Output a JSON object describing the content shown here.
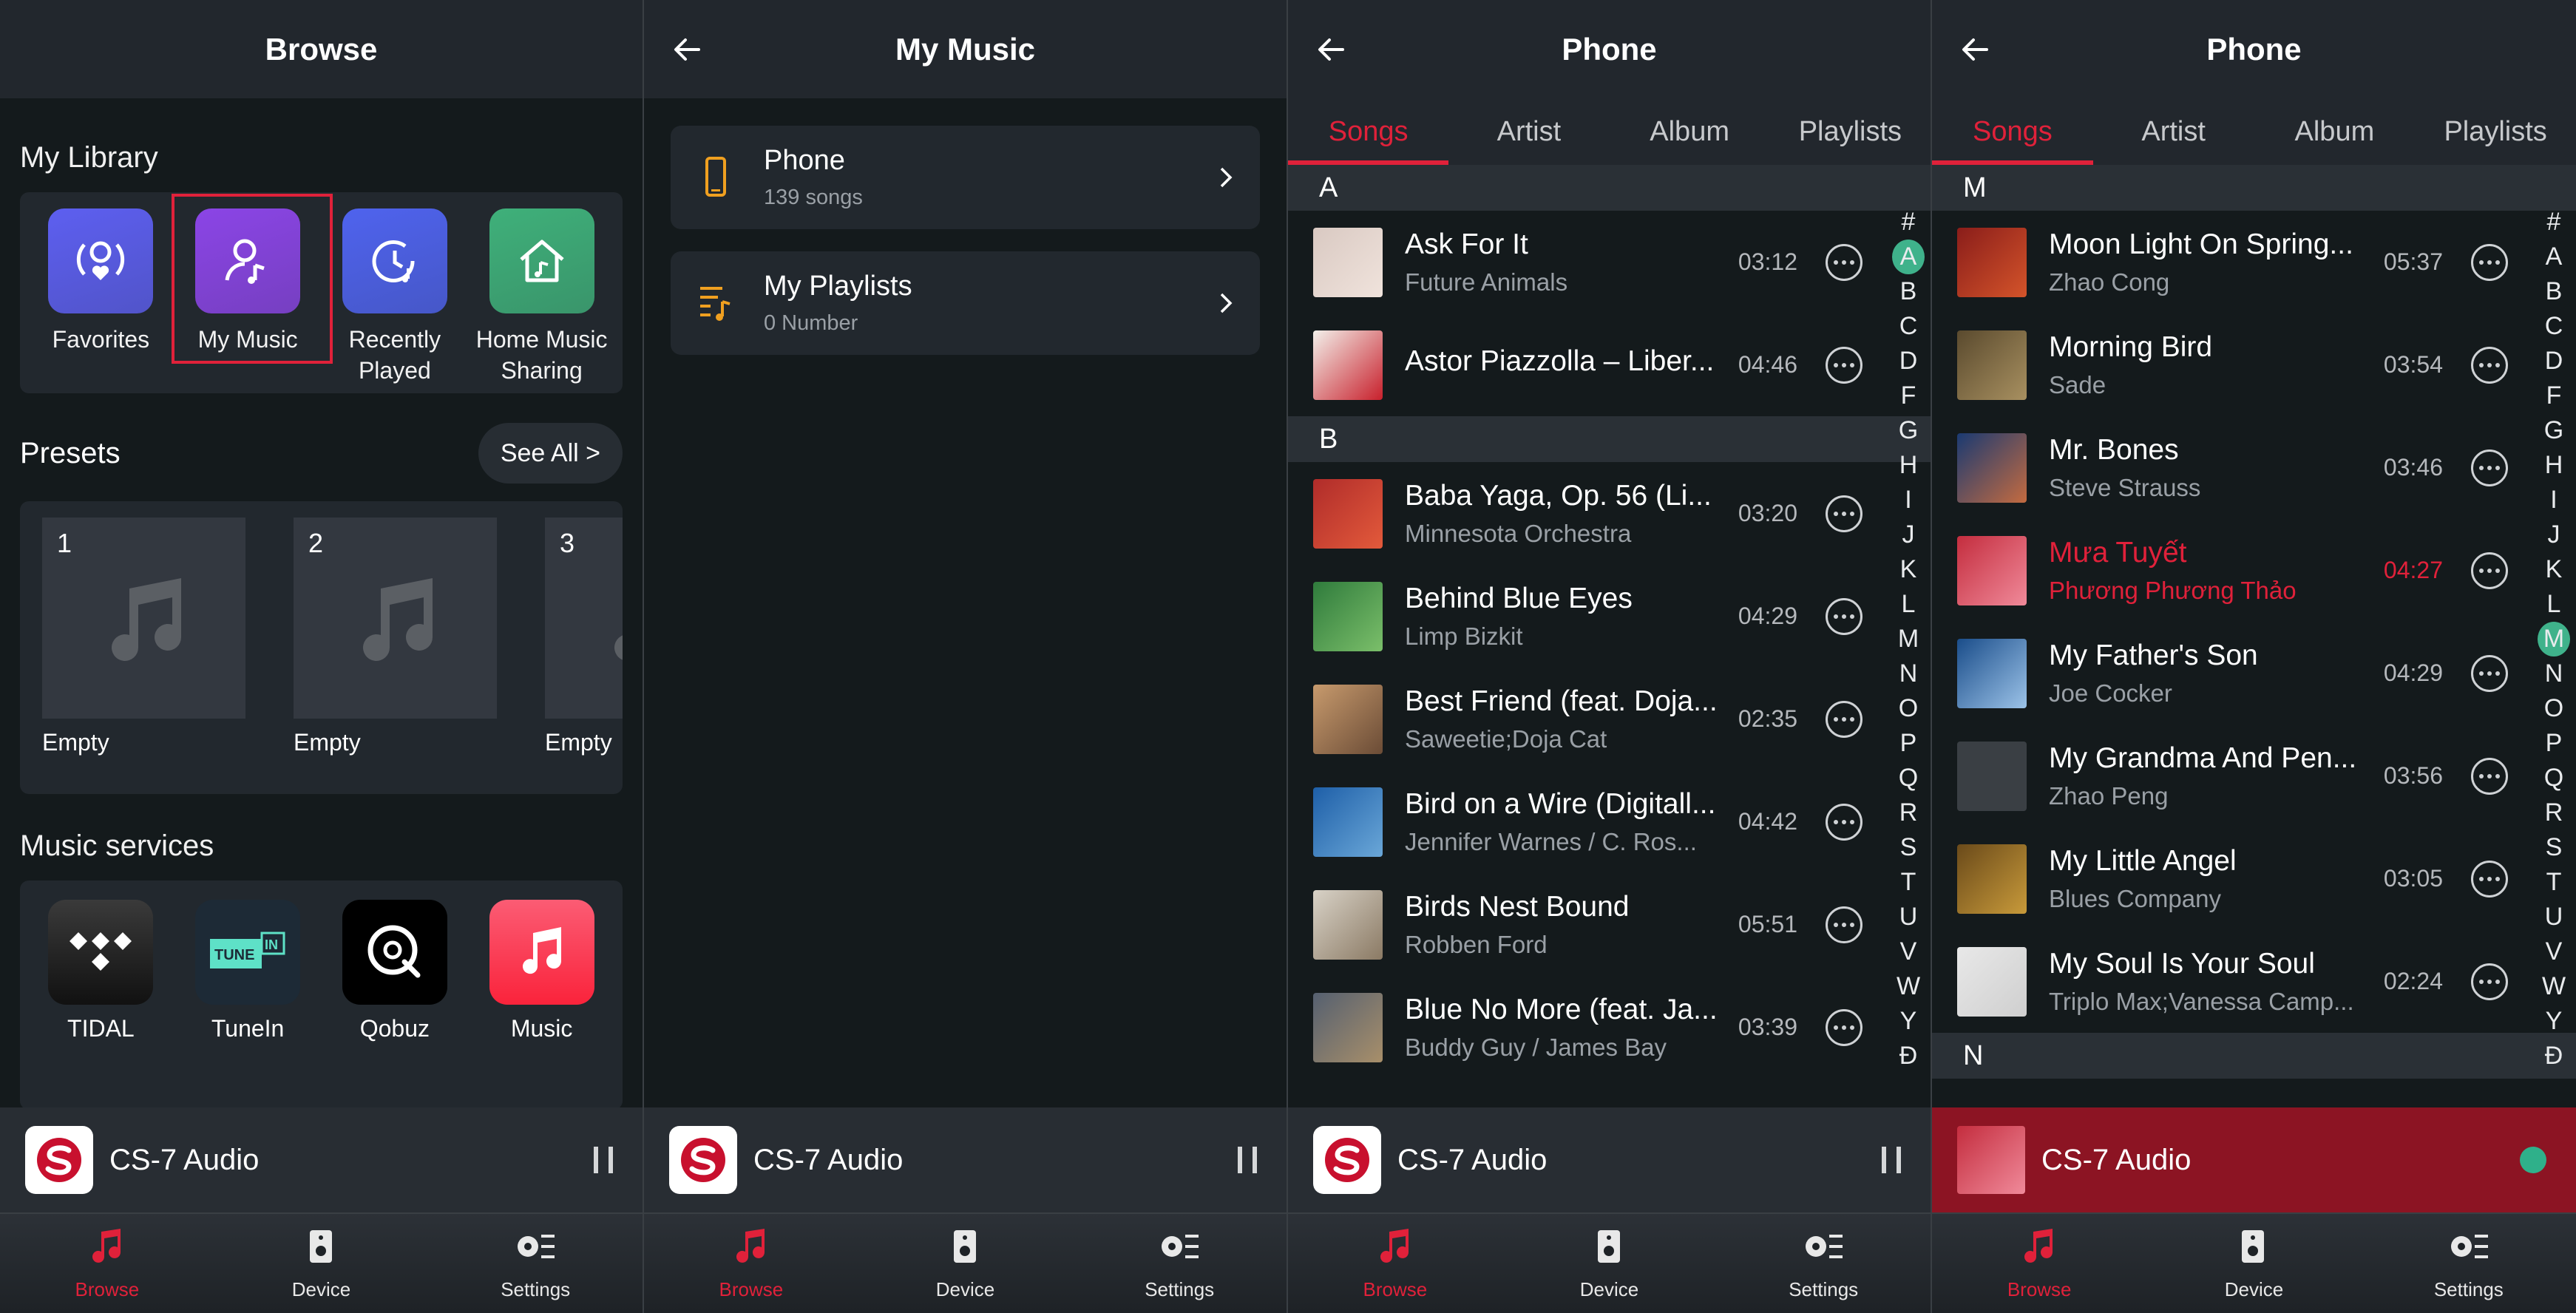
{
  "accent": "#e0213a",
  "screens": {
    "browse": {
      "title": "Browse",
      "my_library_label": "My Library",
      "library": [
        {
          "label": "Favorites",
          "icon": "favorites-icon",
          "color": "#5d5ff0"
        },
        {
          "label": "My Music",
          "icon": "my-music-icon",
          "color": "#8b45e6",
          "selected": true
        },
        {
          "label": "Recently\nPlayed",
          "icon": "clock-icon",
          "color": "#4f63ee"
        },
        {
          "label": "Home Music\nSharing",
          "icon": "home-music-icon",
          "color": "#3fb07a"
        }
      ],
      "presets_label": "Presets",
      "see_all": "See All  >",
      "presets": [
        {
          "num": "1",
          "label": "Empty"
        },
        {
          "num": "2",
          "label": "Empty"
        },
        {
          "num": "3",
          "label": "Empty"
        }
      ],
      "music_services_label": "Music services",
      "services": [
        {
          "label": "TIDAL",
          "icon": "tidal-icon"
        },
        {
          "label": "TuneIn",
          "icon": "tunein-icon"
        },
        {
          "label": "Qobuz",
          "icon": "qobuz-icon"
        },
        {
          "label": "Music",
          "icon": "apple-music-icon"
        }
      ]
    },
    "my_music": {
      "title": "My Music",
      "items": [
        {
          "title": "Phone",
          "subtitle": "139 songs",
          "icon": "phone-icon"
        },
        {
          "title": "My Playlists",
          "subtitle": "0 Number",
          "icon": "playlist-icon"
        }
      ]
    },
    "phone_a": {
      "title": "Phone",
      "tabs": [
        "Songs",
        "Artist",
        "Album",
        "Playlists"
      ],
      "sections": [
        {
          "letter": "A",
          "songs": [
            {
              "title": "Ask For It",
              "artist": "Future Animals",
              "duration": "03:12"
            },
            {
              "title": "Astor Piazzolla – Liber...",
              "artist": "",
              "duration": "04:46"
            }
          ]
        },
        {
          "letter": "B",
          "songs": [
            {
              "title": "Baba Yaga, Op. 56 (Li...",
              "artist": "Minnesota Orchestra",
              "duration": "03:20"
            },
            {
              "title": "Behind Blue Eyes",
              "artist": "Limp Bizkit",
              "duration": "04:29"
            },
            {
              "title": "Best Friend (feat. Doja...",
              "artist": "Saweetie;Doja Cat",
              "duration": "02:35"
            },
            {
              "title": "Bird on a Wire (Digitall...",
              "artist": "Jennifer Warnes / C. Ros...",
              "duration": "04:42"
            },
            {
              "title": "Birds Nest Bound",
              "artist": "Robben Ford",
              "duration": "05:51"
            },
            {
              "title": "Blue No More (feat. Ja...",
              "artist": "Buddy Guy / James Bay",
              "duration": "03:39"
            }
          ]
        }
      ]
    },
    "phone_m": {
      "title": "Phone",
      "tabs": [
        "Songs",
        "Artist",
        "Album",
        "Playlists"
      ],
      "sections": [
        {
          "letter": "M",
          "songs": [
            {
              "title": "Moon Light On Spring...",
              "artist": "Zhao Cong",
              "duration": "05:37"
            },
            {
              "title": "Morning Bird",
              "artist": "Sade",
              "duration": "03:54"
            },
            {
              "title": "Mr. Bones",
              "artist": "Steve Strauss",
              "duration": "03:46"
            },
            {
              "title": "Mưa Tuyết",
              "artist": "Phương Phương Thảo",
              "duration": "04:27",
              "playing": true
            },
            {
              "title": "My Father's Son",
              "artist": "Joe Cocker",
              "duration": "04:29"
            },
            {
              "title": "My Grandma And Pen...",
              "artist": "Zhao Peng",
              "duration": "03:56"
            },
            {
              "title": "My Little Angel",
              "artist": "Blues Company",
              "duration": "03:05"
            },
            {
              "title": "My Soul Is Your Soul",
              "artist": "Triplo Max;Vanessa Camp...",
              "duration": "02:24"
            }
          ]
        },
        {
          "letter": "N",
          "songs": []
        }
      ]
    }
  },
  "index_letters": [
    "#",
    "A",
    "B",
    "C",
    "D",
    "F",
    "G",
    "H",
    "I",
    "J",
    "K",
    "L",
    "M",
    "N",
    "O",
    "P",
    "Q",
    "R",
    "S",
    "T",
    "U",
    "V",
    "W",
    "Y",
    "Đ"
  ],
  "mini_player": {
    "title": "CS-7 Audio"
  },
  "nav": [
    {
      "label": "Browse",
      "icon": "music-note-icon"
    },
    {
      "label": "Device",
      "icon": "speaker-icon"
    },
    {
      "label": "Settings",
      "icon": "settings-icon"
    }
  ]
}
